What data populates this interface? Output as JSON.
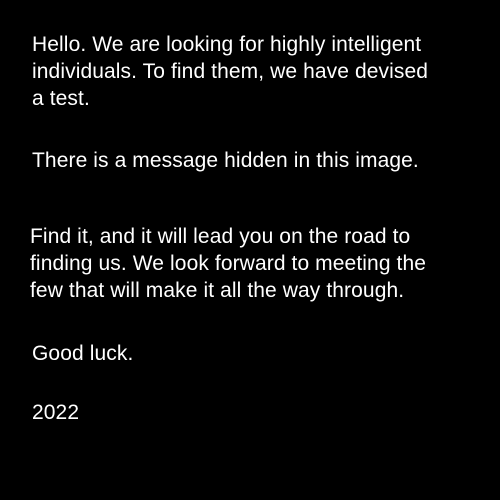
{
  "background_color": "#000000",
  "text_color": "#ffffff",
  "message": {
    "paragraph_1": [
      "Hello. We are looking for highly intelligent",
      "individuals. To find them, we have devised",
      "a test."
    ],
    "paragraph_2": [
      "There is a message hidden in this image."
    ],
    "paragraph_3": [
      "Find it, and it will lead you on the road to",
      "finding us. We look forward to meeting the",
      "few that will make it all the way through."
    ],
    "paragraph_4": [
      "Good luck."
    ],
    "year": "2022"
  }
}
